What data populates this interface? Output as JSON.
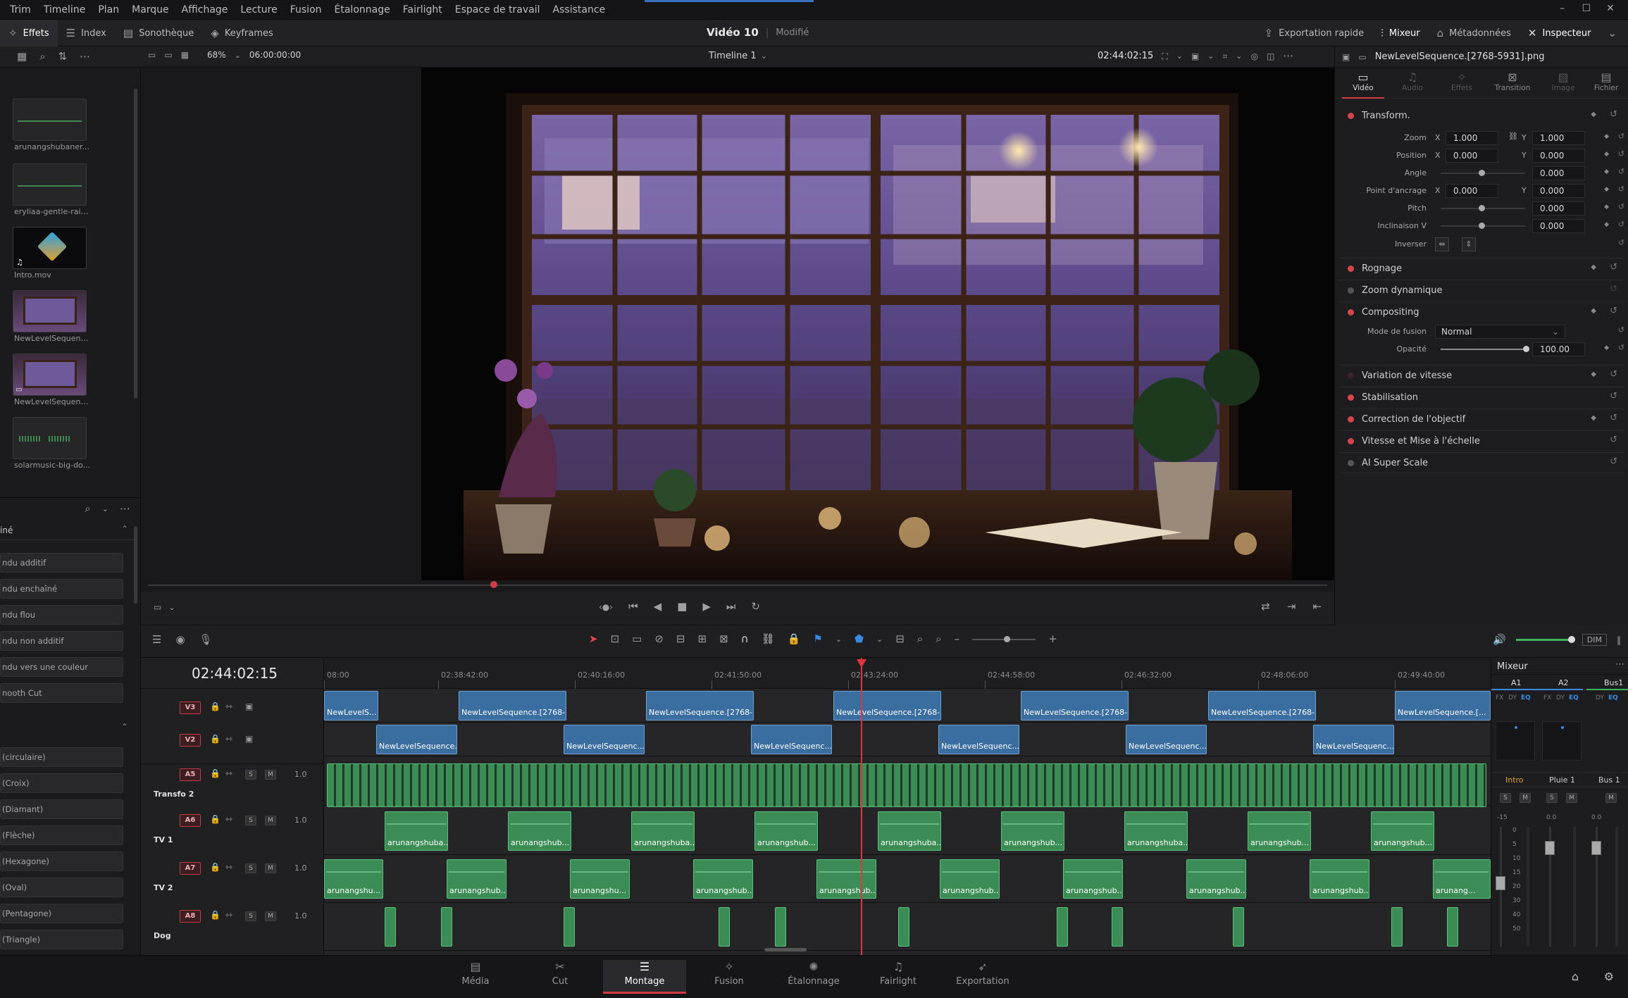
{
  "menu": [
    "Trim",
    "Timeline",
    "Plan",
    "Marque",
    "Affichage",
    "Lecture",
    "Fusion",
    "Étalonnage",
    "Fairlight",
    "Espace de travail",
    "Assistance"
  ],
  "toolbar": {
    "effects": "Effets",
    "index": "Index",
    "sound_library": "Sonothèque",
    "keyframes": "Keyframes",
    "project_title": "Vidéo 10",
    "project_status": "Modifié",
    "quick_export": "Exportation rapide",
    "mixer": "Mixeur",
    "metadata": "Métadonnées",
    "inspector": "Inspecteur"
  },
  "viewer": {
    "zoom": "68%",
    "source_timecode": "06:00:00:00",
    "timeline_name": "Timeline 1",
    "record_timecode": "02:44:02:15",
    "clip_name": "NewLevelSequence.[2768-5931].png"
  },
  "media_pool": {
    "items": [
      {
        "label": "arunangshubaner..."
      },
      {
        "label": "eryliaa-gentle-rain..."
      },
      {
        "label": "Intro.mov"
      },
      {
        "label": "NewLevelSequenc..."
      },
      {
        "label": "NewLevelSequenc..."
      },
      {
        "label": "solarmusic-big-do..."
      }
    ]
  },
  "effects_list": {
    "section_1": "iné",
    "items_1": [
      "ndu additif",
      "ndu enchaîné",
      "ndu flou",
      "ndu non additif",
      "ndu vers une couleur",
      "nooth Cut"
    ],
    "items_2": [
      "(circulaire)",
      "(Croix)",
      "(Diamant)",
      "(Flèche)",
      "(Hexagone)",
      "(Oval)",
      "(Pentagone)",
      "(Triangle)"
    ]
  },
  "inspector": {
    "tabs": [
      "Vidéo",
      "Audio",
      "Effets",
      "Transition",
      "Image",
      "Fichier"
    ],
    "transform_title": "Transform.",
    "zoom_label": "Zoom",
    "zoom_x": "1.000",
    "zoom_y": "1.000",
    "position_label": "Position",
    "position_x": "0.000",
    "position_y": "0.000",
    "angle_label": "Angle",
    "angle_val": "0.000",
    "anchor_label": "Point d'ancrage",
    "anchor_x": "0.000",
    "anchor_y": "0.000",
    "pitch_label": "Pitch",
    "pitch_val": "0.000",
    "tilt_label": "Inclinaison V",
    "tilt_val": "0.000",
    "flip_label": "Inverser",
    "x": "X",
    "y": "Y",
    "crop": "Rognage",
    "dynamic_zoom": "Zoom dynamique",
    "compositing": "Compositing",
    "blend_label": "Mode de fusion",
    "blend_val": "Normal",
    "opacity_label": "Opacité",
    "opacity_val": "100.00",
    "speed_change": "Variation de vitesse",
    "stabilization": "Stabilisation",
    "lens_correction": "Correction de l'objectif",
    "scaling": "Vitesse et Mise à l'échelle",
    "superscale": "AI Super Scale"
  },
  "timeline": {
    "timecode": "02:44:02:15",
    "ruler": [
      "08:00",
      "02:38:42:00",
      "02:40:16:00",
      "02:41:50:00",
      "02:43:24:00",
      "02:44:58:00",
      "02:46:32:00",
      "02:48:06:00",
      "02:49:40:00"
    ],
    "tracks": {
      "v3": "V3",
      "v2": "V2",
      "a5": "A5",
      "a5_name": "Transfo 2",
      "a5_vol": "1.0",
      "a6": "A6",
      "a6_name": "TV 1",
      "a6_vol": "1.0",
      "a7": "A7",
      "a7_name": "TV 2",
      "a7_vol": "1.0",
      "a8": "A8",
      "a8_name": "Dog",
      "a8_vol": "1.0"
    },
    "solo": "S",
    "mute": "M",
    "v3_clips": [
      "NewLevelS...",
      "NewLevelSequence.[2768-...",
      "NewLevelSequence.[2768-...",
      "NewLevelSequence.[2768-...",
      "NewLevelSequence.[2768-...",
      "NewLevelSequence.[2768-...",
      "NewLevelSequence.[..."
    ],
    "v2_clips": [
      "NewLevelSequence...",
      "NewLevelSequenc...",
      "NewLevelSequenc...",
      "NewLevelSequenc...",
      "NewLevelSequenc...",
      "NewLevelSequenc..."
    ],
    "a6_clips": [
      "arunangshuba...",
      "arunangshub...",
      "arunangshuba...",
      "arunangshub...",
      "arunangshuba...",
      "arunangshub...",
      "arunangshuba...",
      "arunangshub...",
      "arunangshub..."
    ],
    "a7_clips": [
      "arunangshu...",
      "arunangshub...",
      "arunangshu...",
      "arunangshub...",
      "arunangshub...",
      "arunangshub...",
      "arunangshub...",
      "arunangshub...",
      "arunangshub...",
      "arunang..."
    ]
  },
  "mixer": {
    "title": "Mixeur",
    "channels": [
      "A1",
      "A2",
      "Bus1"
    ],
    "names": [
      "Intro",
      "Pluie 1",
      "Bus 1"
    ],
    "fx": "FX",
    "dy": "DY",
    "eq": "EQ",
    "dim": "DIM",
    "db_a1": "-15",
    "db_a2": "0.0",
    "db_bus": "0.0",
    "scale": [
      "0",
      "5",
      "10",
      "15",
      "20",
      "30",
      "40",
      "50"
    ]
  },
  "pages": [
    "Média",
    "Cut",
    "Montage",
    "Fusion",
    "Étalonnage",
    "Fairlight",
    "Exportation"
  ],
  "colors": {
    "accent": "#d33b44",
    "video_clip": "#3a6ea0",
    "audio_clip": "#3b8c55"
  }
}
